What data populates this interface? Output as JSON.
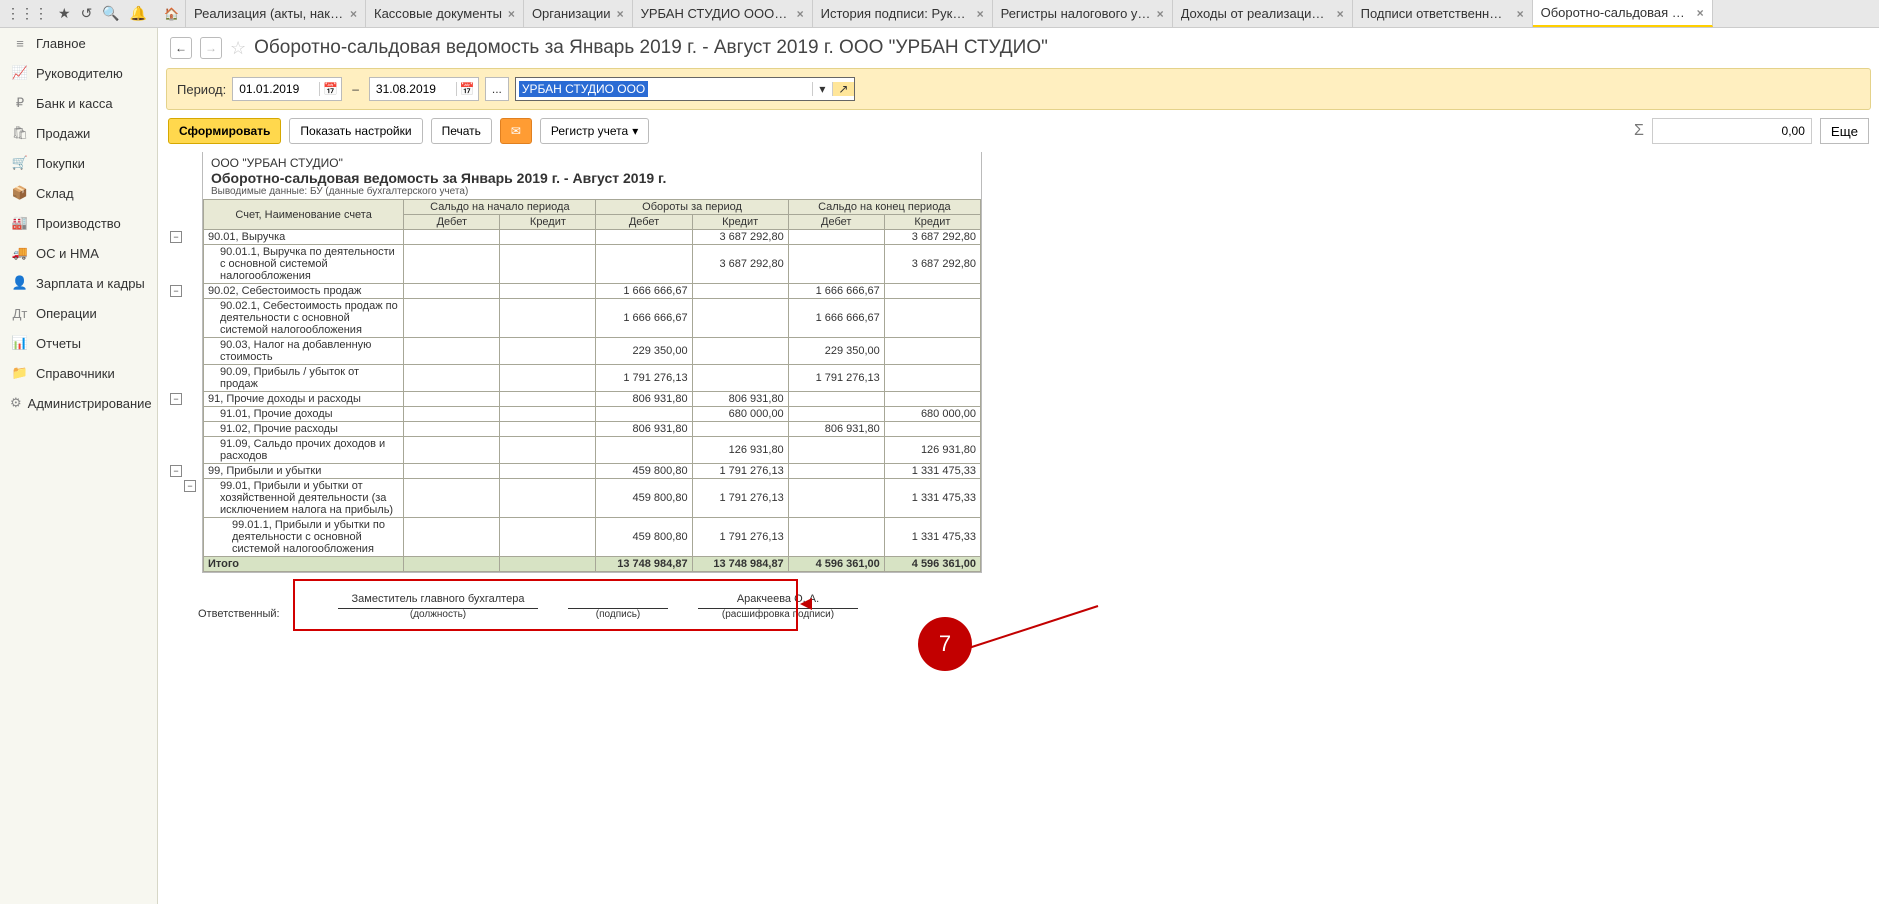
{
  "tabs": [
    "Реализация (акты, накла...",
    "Кассовые документы",
    "Организации",
    "УРБАН СТУДИО ООО (О...",
    "История подписи: Руков...",
    "Регистры налогового учета",
    "Доходы от реализации то...",
    "Подписи ответственных ...",
    "Оборотно-сальдовая вед..."
  ],
  "active_tab": 8,
  "nav": [
    {
      "icon": "≡",
      "label": "Главное"
    },
    {
      "icon": "📈",
      "label": "Руководителю"
    },
    {
      "icon": "₽",
      "label": "Банк и касса"
    },
    {
      "icon": "🛍",
      "label": "Продажи"
    },
    {
      "icon": "🛒",
      "label": "Покупки"
    },
    {
      "icon": "📦",
      "label": "Склад"
    },
    {
      "icon": "🏭",
      "label": "Производство"
    },
    {
      "icon": "🚚",
      "label": "ОС и НМА"
    },
    {
      "icon": "👤",
      "label": "Зарплата и кадры"
    },
    {
      "icon": "Дт",
      "label": "Операции"
    },
    {
      "icon": "📊",
      "label": "Отчеты"
    },
    {
      "icon": "📁",
      "label": "Справочники"
    },
    {
      "icon": "⚙",
      "label": "Администрирование"
    }
  ],
  "title": "Оборотно-сальдовая ведомость за Январь 2019 г. - Август 2019 г. ООО \"УРБАН СТУДИО\"",
  "period_label": "Период:",
  "date_from": "01.01.2019",
  "date_to": "31.08.2019",
  "dots": "...",
  "org": "УРБАН СТУДИО ООО",
  "btn_form": "Сформировать",
  "btn_settings": "Показать настройки",
  "btn_print": "Печать",
  "btn_reg": "Регистр учета",
  "sum_value": "0,00",
  "btn_more": "Еще",
  "report": {
    "org": "ООО \"УРБАН СТУДИО\"",
    "title": "Оборотно-сальдовая ведомость за Январь 2019 г. - Август 2019 г.",
    "sub": "Выводимые данные: БУ (данные бухгалтерского учета)"
  },
  "th": {
    "acc": "Счет, Наименование счета",
    "g1": "Сальдо на начало периода",
    "g2": "Обороты за период",
    "g3": "Сальдо на конец периода",
    "d": "Дебет",
    "k": "Кредит"
  },
  "rows": [
    {
      "t": 1,
      "lvl": 0,
      "acc": "90.01, Выручка",
      "v": [
        "",
        "",
        "",
        "3 687 292,80",
        "",
        "3 687 292,80"
      ]
    },
    {
      "lvl": 1,
      "acc": "90.01.1, Выручка по деятельности с основной системой налогообложения",
      "v": [
        "",
        "",
        "",
        "3 687 292,80",
        "",
        "3 687 292,80"
      ]
    },
    {
      "t": 1,
      "lvl": 0,
      "acc": "90.02, Себестоимость продаж",
      "v": [
        "",
        "",
        "1 666 666,67",
        "",
        "1 666 666,67",
        ""
      ]
    },
    {
      "lvl": 1,
      "acc": "90.02.1, Себестоимость продаж по деятельности с основной системой налогообложения",
      "v": [
        "",
        "",
        "1 666 666,67",
        "",
        "1 666 666,67",
        ""
      ]
    },
    {
      "lvl": 1,
      "acc": "90.03, Налог на добавленную стоимость",
      "v": [
        "",
        "",
        "229 350,00",
        "",
        "229 350,00",
        ""
      ]
    },
    {
      "lvl": 1,
      "acc": "90.09, Прибыль / убыток от продаж",
      "v": [
        "",
        "",
        "1 791 276,13",
        "",
        "1 791 276,13",
        ""
      ]
    },
    {
      "t": 1,
      "lvl": 0,
      "acc": "91, Прочие доходы и расходы",
      "v": [
        "",
        "",
        "806 931,80",
        "806 931,80",
        "",
        ""
      ]
    },
    {
      "lvl": 1,
      "acc": "91.01, Прочие доходы",
      "v": [
        "",
        "",
        "",
        "680 000,00",
        "",
        "680 000,00"
      ]
    },
    {
      "lvl": 1,
      "acc": "91.02, Прочие расходы",
      "v": [
        "",
        "",
        "806 931,80",
        "",
        "806 931,80",
        ""
      ]
    },
    {
      "lvl": 1,
      "acc": "91.09, Сальдо прочих доходов и расходов",
      "v": [
        "",
        "",
        "",
        "126 931,80",
        "",
        "126 931,80"
      ]
    },
    {
      "t": 1,
      "lvl": 0,
      "acc": "99, Прибыли и убытки",
      "v": [
        "",
        "",
        "459 800,80",
        "1 791 276,13",
        "",
        "1 331 475,33"
      ]
    },
    {
      "t": 1,
      "lvl": 1,
      "acc": "99.01, Прибыли и убытки от хозяйственной деятельности (за исключением налога на прибыль)",
      "v": [
        "",
        "",
        "459 800,80",
        "1 791 276,13",
        "",
        "1 331 475,33"
      ]
    },
    {
      "lvl": 2,
      "acc": "99.01.1, Прибыли и убытки по деятельности с основной системой налогообложения",
      "v": [
        "",
        "",
        "459 800,80",
        "1 791 276,13",
        "",
        "1 331 475,33"
      ]
    }
  ],
  "total": {
    "label": "Итого",
    "v": [
      "",
      "",
      "13 748 984,87",
      "13 748 984,87",
      "4 596 361,00",
      "4 596 361,00"
    ]
  },
  "sig": {
    "resp": "Ответственный:",
    "pos": "Заместитель главного бухгалтера",
    "pos_sub": "(должность)",
    "sign_sub": "(подпись)",
    "name": "Аракчеева О. А.",
    "name_sub": "(расшифровка подписи)"
  },
  "annot": "7"
}
